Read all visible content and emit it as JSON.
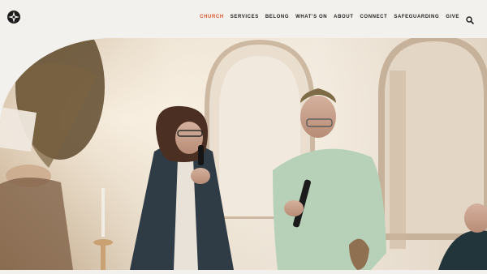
{
  "header": {
    "nav_items": [
      {
        "label": "CHURCH",
        "active": true
      },
      {
        "label": "SERVICES",
        "active": false
      },
      {
        "label": "BELONG",
        "active": false
      },
      {
        "label": "WHAT'S ON",
        "active": false
      },
      {
        "label": "ABOUT",
        "active": false
      },
      {
        "label": "CONNECT",
        "active": false
      },
      {
        "label": "SAFEGUARDING",
        "active": false
      },
      {
        "label": "GIVE",
        "active": false
      }
    ],
    "logo_icon": "compass-star-logo",
    "search_icon": "search-icon"
  },
  "hero": {
    "image_description": "",
    "accent_color": "#d9542b"
  }
}
